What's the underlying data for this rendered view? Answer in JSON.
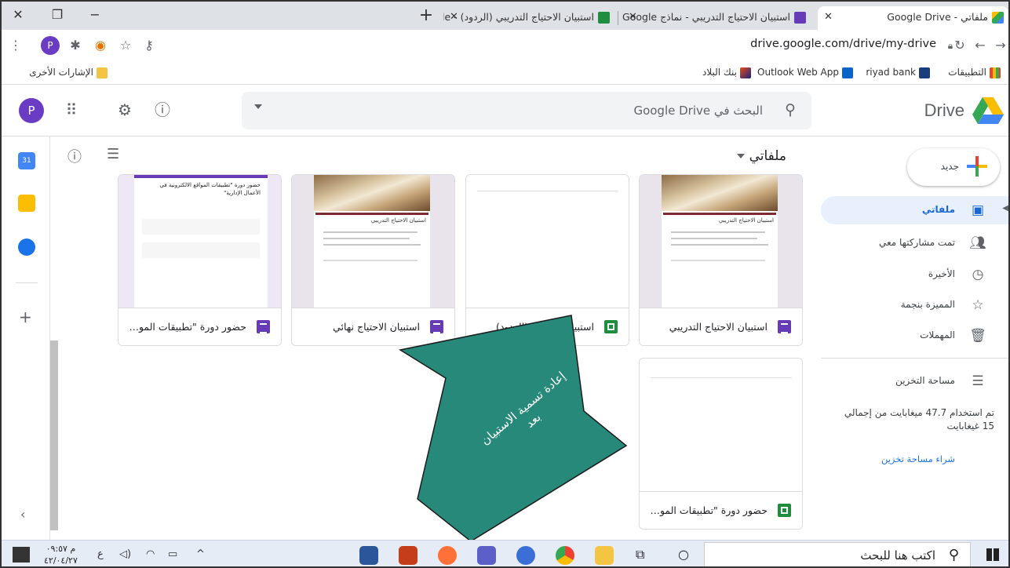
{
  "browser": {
    "tabs": [
      {
        "title": "ملفاتي - Google Drive",
        "active": true
      },
      {
        "title": "استبيان الاحتياج التدريبي - نماذج Google",
        "active": false
      },
      {
        "title": "استبيان الاحتياج التدريبي (الردود) - Google",
        "active": false
      }
    ],
    "url": "drive.google.com/drive/my-drive",
    "bookmarks": {
      "apps": "التطبيقات",
      "riyad": "riyad bank",
      "outlook": "Outlook Web App",
      "albilad": "بنك البلاد",
      "other": "الإشارات الأخرى"
    }
  },
  "drive": {
    "logo": "Drive",
    "search_placeholder": "البحث في Google Drive",
    "avatar_letter": "P",
    "breadcrumb": "ملفاتي",
    "new_button": "جديد",
    "nav": [
      {
        "label": "ملفاتي",
        "icon": "my-drive-icon",
        "active": true
      },
      {
        "label": "تمت مشاركتها معي",
        "icon": "shared-icon",
        "active": false
      },
      {
        "label": "الأخيرة",
        "icon": "clock-icon",
        "active": false
      },
      {
        "label": "المميزة بنجمة",
        "icon": "star-icon",
        "active": false
      },
      {
        "label": "المهملات",
        "icon": "trash-icon",
        "active": false
      }
    ],
    "storage": {
      "label": "مساحة التخزين",
      "usage": "تم استخدام 47.7 ميغابايت من إجمالي 15 غيغابايت",
      "buy": "شراء مساحة تخزين"
    },
    "files": [
      {
        "name": "استبيان الاحتياج التدريبي",
        "type": "form",
        "thumb_title": "استبيان الاحتياج التدريبي"
      },
      {
        "name": "استبيان الاحتياج (الردود)",
        "type": "sheet",
        "thumb_title": ""
      },
      {
        "name": "استبيان الاحتياج نهائي",
        "type": "form",
        "thumb_title": "استبيان الاحتياج التدريبي"
      },
      {
        "name": "حضور دورة \"تطبيقات المواقع ...",
        "type": "form",
        "thumb_title": "حضور دورة \"تطبيقات المواقع الالكترونية في الأعمال الإدارية\""
      },
      {
        "name": "حضور دورة \"تطبيقات المواقع ...",
        "type": "sheet",
        "thumb_title": ""
      }
    ],
    "annotation": "إعادة تسمية الاستبيان بعد"
  },
  "taskbar": {
    "search_placeholder": "اكتب هنا للبحث",
    "time": "م ٠٩:٥٧",
    "date": "٤٢/٠٤/٢٧",
    "lang": "ع"
  }
}
